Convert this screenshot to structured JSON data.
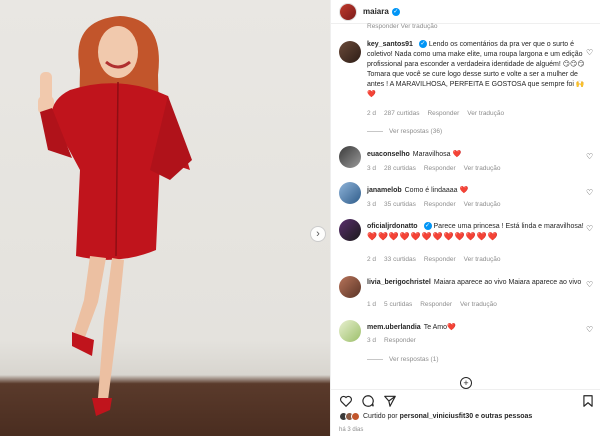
{
  "header": {
    "username": "maiara",
    "verified": true
  },
  "cutoff_meta": {
    "text": "Responder    Ver tradução"
  },
  "comments": [
    {
      "user": "key_santos91",
      "verified": true,
      "text": "Lendo os comentários da pra ver que o surto é coletivo! Nada como uma make elite, uma roupa largona e um edição profissional para esconder a verdadeira identidade de alguém! 😏😏😏 Tomara que você se cure logo desse surto e volte a ser a mulher de antes ! A MARAVILHOSA, PERFEITA E GOSTOSA que sempre foi 🙌❤️",
      "age": "2 d",
      "likes": "287 curtidas",
      "reply": "Responder",
      "translate": "Ver tradução",
      "replies": "Ver respostas (36)"
    },
    {
      "user": "euaconselho",
      "verified": false,
      "text": "Maravilhosa ❤️",
      "age": "3 d",
      "likes": "28 curtidas",
      "reply": "Responder",
      "translate": "Ver tradução"
    },
    {
      "user": "janamelob",
      "verified": false,
      "text": "Como é lindaaaa ❤️",
      "age": "3 d",
      "likes": "35 curtidas",
      "reply": "Responder",
      "translate": "Ver tradução"
    },
    {
      "user": "oficialjrdonatto",
      "verified": true,
      "text": "Parece uma princesa ! Está linda e maravilhosa!",
      "hearts": "❤️❤️❤️❤️❤️❤️❤️❤️❤️❤️❤️❤️",
      "age": "2 d",
      "likes": "33 curtidas",
      "reply": "Responder",
      "translate": "Ver tradução"
    },
    {
      "user": "livia_berigochristel",
      "verified": false,
      "text": "Maiara aparece ao vivo Maiara aparece ao vivo",
      "age": "1 d",
      "likes": "5 curtidas",
      "reply": "Responder",
      "translate": "Ver tradução"
    },
    {
      "user": "mem.uberlandia",
      "verified": false,
      "text": "Te Amo❤️",
      "age": "3 d",
      "likes": "",
      "reply": "Responder",
      "translate": "",
      "replies": "Ver respostas (1)"
    }
  ],
  "footer": {
    "liked_prefix": "Curtido por",
    "liked_user": "personal_viniciusfit30",
    "liked_suffix": "e outras pessoas",
    "time": "há 3 dias"
  },
  "icons": [
    "heart-icon",
    "comment-icon",
    "share-icon",
    "bookmark-icon",
    "chevron-right-icon",
    "plus-circle-icon"
  ],
  "colors": {
    "accent": "#0095f6",
    "heart": "#d6001c",
    "dress": "#c0141c"
  }
}
